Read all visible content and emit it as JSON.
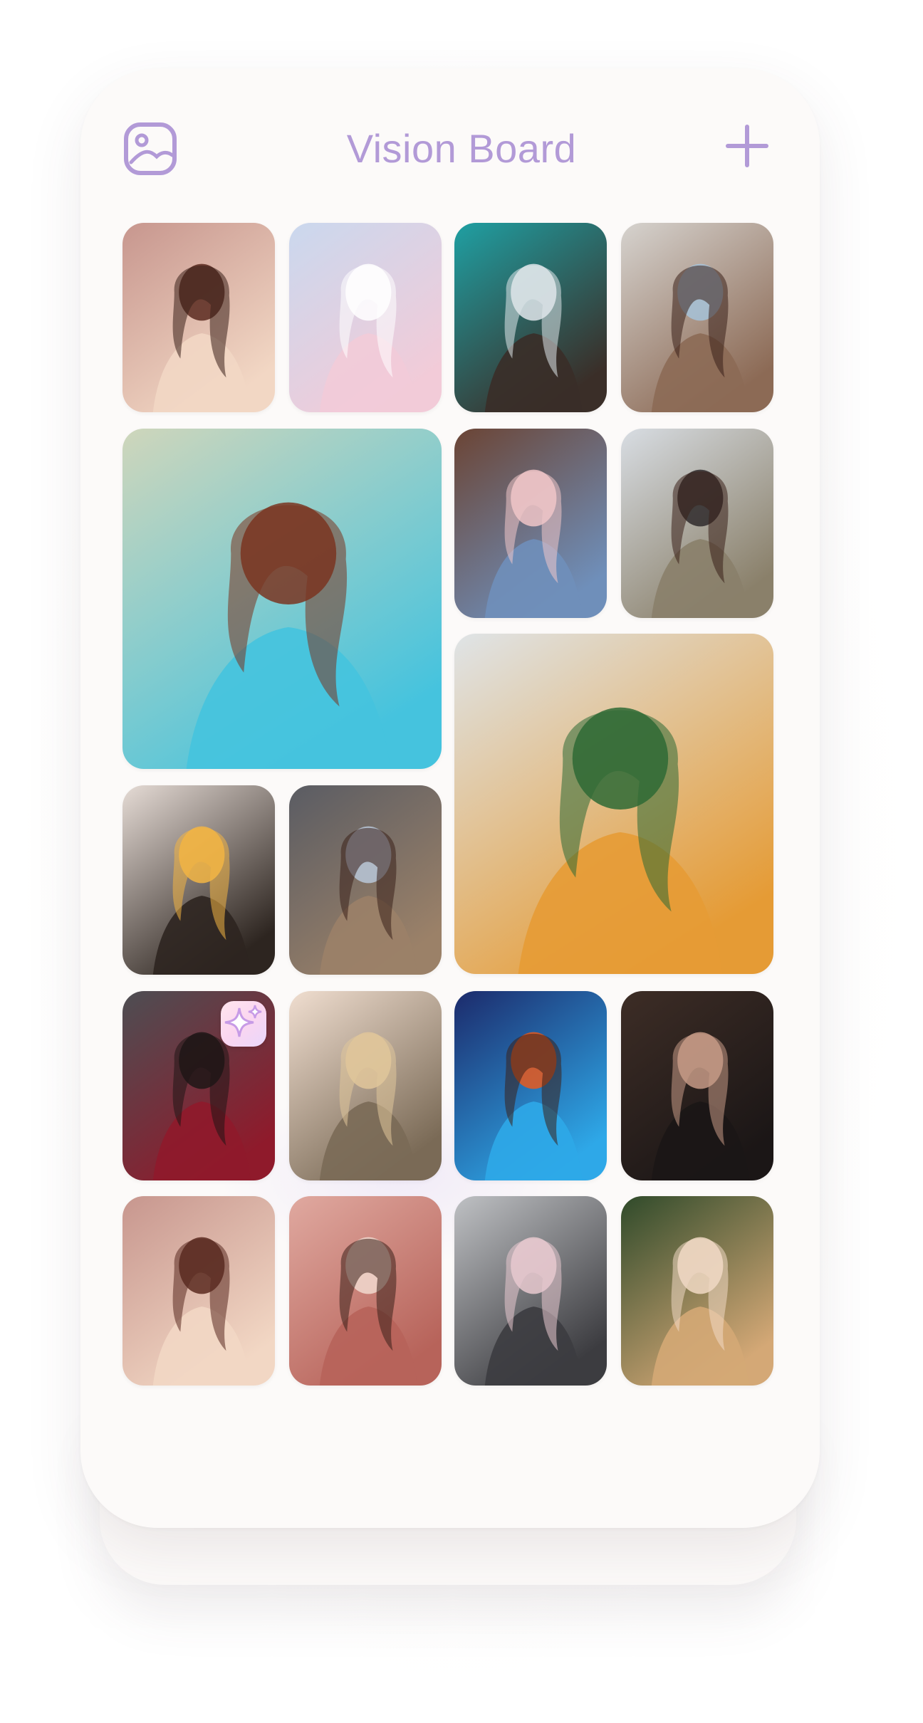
{
  "app": {
    "title": "Vision Board",
    "accent_color": "#b29ad7",
    "background_color": "#fcfaf9"
  },
  "header": {
    "left_icon": "gallery-icon",
    "right_icon": "plus-icon"
  },
  "tiles": [
    {
      "name": "photo-portrait-girl-sunset",
      "palette": [
        "#c7968e",
        "#f2d7c4",
        "#5a2a20"
      ]
    },
    {
      "name": "photo-ballet-dancer-beach",
      "palette": [
        "#cad8ee",
        "#f2cbd8",
        "#ffffff"
      ]
    },
    {
      "name": "photo-woman-teal-door",
      "palette": [
        "#1fa0a3",
        "#3a2e28",
        "#dfe5ea"
      ]
    },
    {
      "name": "photo-woman-seaside-sunset",
      "palette": [
        "#d6d3cf",
        "#8c6a55",
        "#a6c2d8"
      ]
    },
    {
      "name": "photo-redhead-woman-blue-frame",
      "palette": [
        "#cfd6bb",
        "#45c3de",
        "#7a3521"
      ]
    },
    {
      "name": "photo-woman-sunglasses-brick",
      "palette": [
        "#6b4434",
        "#6f8fba",
        "#f0c6c8"
      ]
    },
    {
      "name": "photo-woman-field-hat",
      "palette": [
        "#d8dde3",
        "#8a806a",
        "#2f2a2c"
      ]
    },
    {
      "name": "photo-woman-straw-hat-pier",
      "palette": [
        "#dfe4e7",
        "#e59b35",
        "#2e6a35"
      ]
    },
    {
      "name": "photo-woman-flower",
      "palette": [
        "#e6dcd6",
        "#2d2520",
        "#f2b544"
      ]
    },
    {
      "name": "photo-woman-cliff-coast",
      "palette": [
        "#5a5c63",
        "#9b8168",
        "#b9c7d8"
      ]
    },
    {
      "name": "photo-woman-red-sweater",
      "palette": [
        "#4d4e53",
        "#8f1a2b",
        "#1f1616"
      ]
    },
    {
      "name": "photo-blonde-ponytail",
      "palette": [
        "#f0ded0",
        "#7a6a56",
        "#e0c69a"
      ]
    },
    {
      "name": "photo-woman-neon-headphones",
      "palette": [
        "#1c2a6b",
        "#2ea8e8",
        "#e85a1e"
      ]
    },
    {
      "name": "photo-woman-black-hat",
      "palette": [
        "#3d2d26",
        "#1b1616",
        "#c69a86"
      ]
    },
    {
      "name": "photo-portrait-girl-sunset-2",
      "palette": [
        "#c7968e",
        "#f2d7c4",
        "#5a2a20"
      ]
    },
    {
      "name": "photo-woman-pink-wall",
      "palette": [
        "#e0a9a0",
        "#b7635a",
        "#f1d9cf"
      ]
    },
    {
      "name": "photo-woman-parking-lot",
      "palette": [
        "#bfc1c4",
        "#3c3c40",
        "#e7c9cf"
      ]
    },
    {
      "name": "photo-blonde-woman-forest",
      "palette": [
        "#2f4a2a",
        "#d4a876",
        "#f1d9c4"
      ]
    }
  ],
  "badge_icon": "sparkles-icon"
}
